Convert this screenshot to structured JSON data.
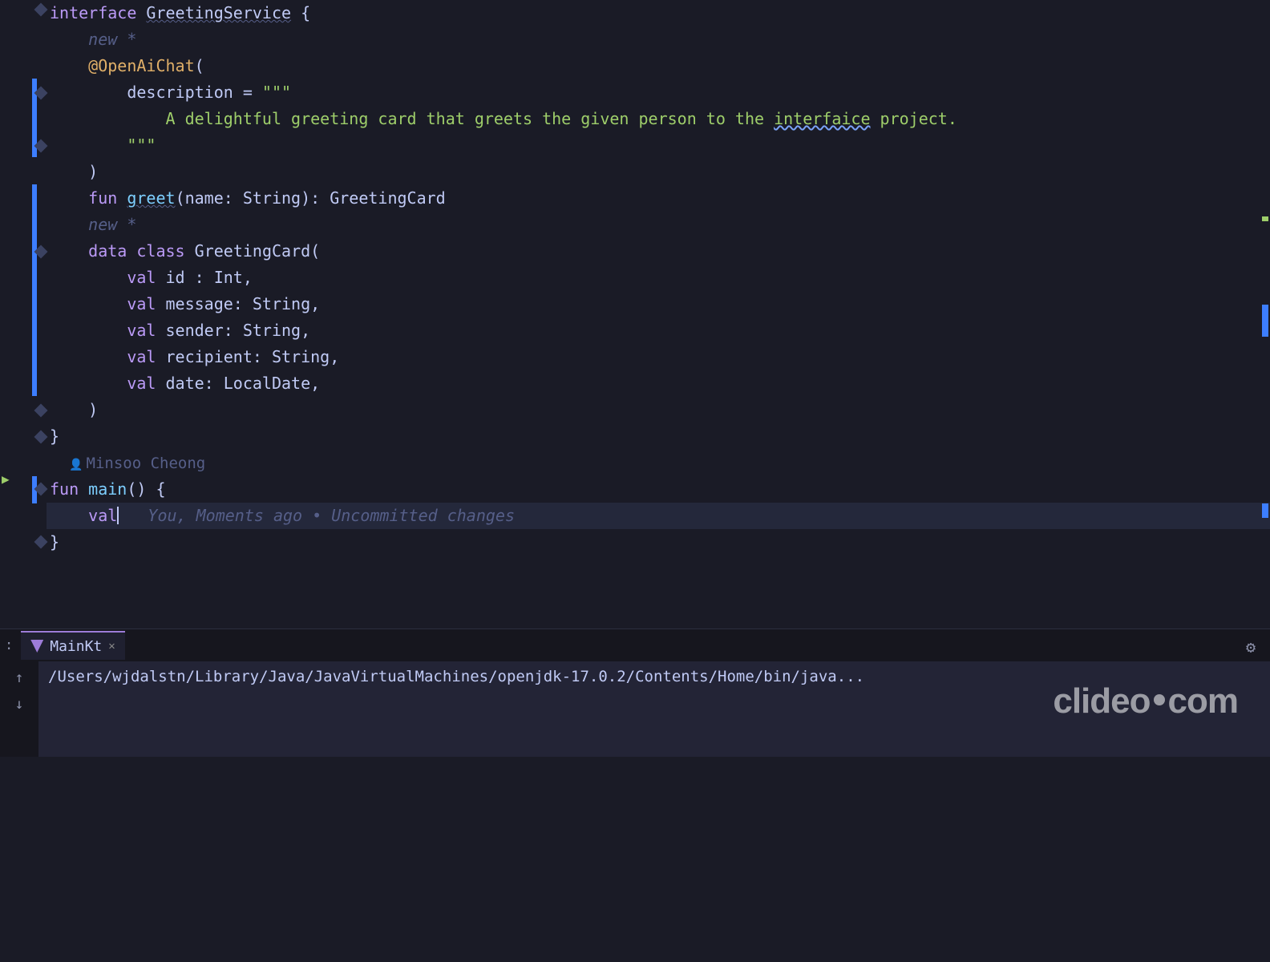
{
  "code": {
    "interface_kw": "interface",
    "interface_name": "GreetingService",
    "brace_open": " {",
    "hint_new": "new *",
    "annotation": "@OpenAiChat",
    "annotation_open": "(",
    "desc_label": "description = ",
    "triple_quote": "\"\"\"",
    "desc_text_1": "A delightful greeting card that greets the given person to the ",
    "desc_text_2": "interfaice",
    "desc_text_3": " project.",
    "paren_close": ")",
    "fun_kw": "fun",
    "greet_name": "greet",
    "greet_params": "(name: String): ",
    "greet_return": "GreetingCard",
    "data_kw": "data",
    "class_kw": "class",
    "card_name": "GreetingCard",
    "card_open": "(",
    "val_kw": "val",
    "field_id": "id",
    "id_type": " : Int",
    "field_message": "message",
    "msg_type": ": String",
    "field_sender": "sender",
    "sender_type": ": String",
    "field_recipient": "recipient",
    "recipient_type": ": String",
    "field_date": "date",
    "date_type": ": LocalDate",
    "comma": ",",
    "brace_close": "}",
    "author": "Minsoo Cheong",
    "main_name": "main",
    "main_sig": "() {",
    "current_val": "val",
    "blame": "You, Moments ago • Uncommitted changes"
  },
  "panel": {
    "run_prefix": ":",
    "tab_label": "MainKt",
    "output": "/Users/wjdalstn/Library/Java/JavaVirtualMachines/openjdk-17.0.2/Contents/Home/bin/java..."
  },
  "watermark": "clideo",
  "watermark2": "com"
}
